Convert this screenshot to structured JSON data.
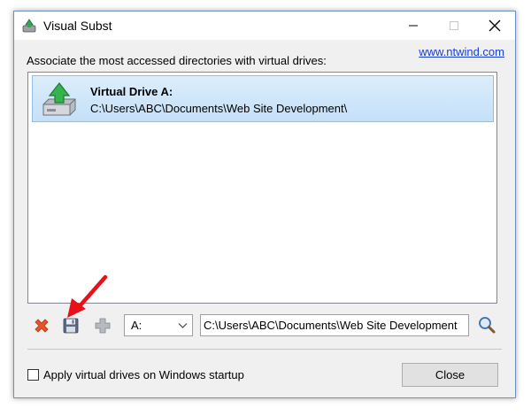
{
  "window": {
    "title": "Visual Subst",
    "link_text": "www.ntwind.com"
  },
  "main": {
    "instruction": "Associate the most accessed directories with virtual drives:",
    "drives": [
      {
        "title": "Virtual Drive A:",
        "path": "C:\\Users\\ABC\\Documents\\Web Site Development\\",
        "selected": true
      }
    ]
  },
  "toolbar": {
    "remove_icon": "red-x-icon",
    "save_icon": "floppy-disk-icon",
    "add_icon": "plus-icon",
    "browse_icon": "magnifier-icon",
    "drive_select_value": "A:",
    "path_value": "C:\\Users\\ABC\\Documents\\Web Site Development"
  },
  "footer": {
    "startup_label": "Apply virtual drives on Windows startup",
    "startup_checked": false,
    "close_label": "Close"
  },
  "colors": {
    "selection": "#cce4f7",
    "link": "#1a3fcc",
    "arrow": "#e8111a"
  }
}
